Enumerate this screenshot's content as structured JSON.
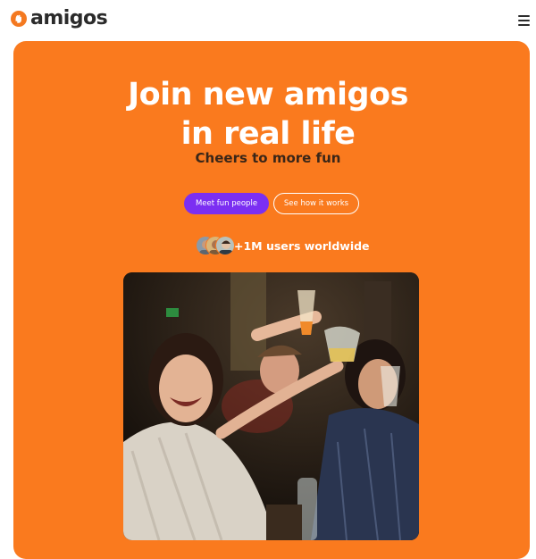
{
  "header": {
    "brand": "amigos",
    "logo_icon": "hand-wave-icon",
    "menu_icon": "hamburger-menu-icon"
  },
  "hero": {
    "title_line1": "Join new amigos",
    "title_line2": "in real life",
    "subtitle": "Cheers to more fun",
    "primary_button": "Meet fun people",
    "secondary_button": "See how it works",
    "users_text": "+1M users worldwide",
    "avatar_count": 3
  },
  "colors": {
    "brand_orange": "#fa7a1e",
    "button_purple": "#7b2ff2",
    "text_dark": "#2b2b2b",
    "subtitle_brown": "#3a2618"
  }
}
